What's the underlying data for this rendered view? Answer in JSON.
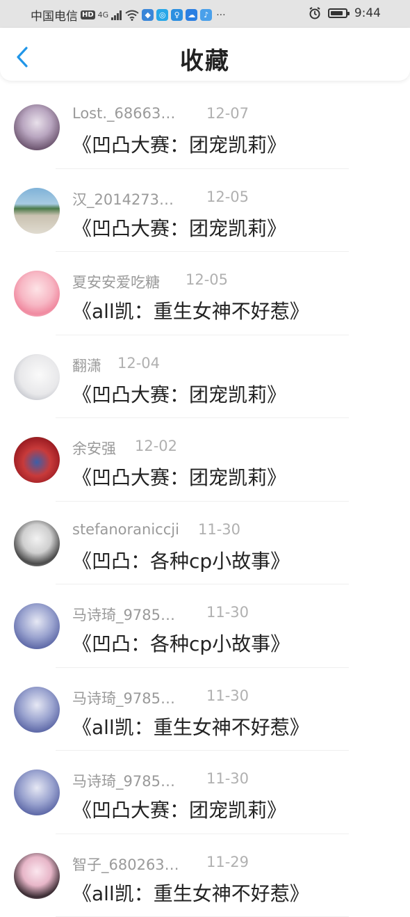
{
  "status_bar": {
    "carrier": "中国电信",
    "hd": "HD",
    "network": "4G",
    "time": "9:44"
  },
  "header": {
    "title": "收藏"
  },
  "items": [
    {
      "name": "Lost._68663…",
      "date": "12-07",
      "book": "《凹凸大赛：团宠凯莉》"
    },
    {
      "name": "汉_2014273…",
      "date": "12-05",
      "book": "《凹凸大赛：团宠凯莉》"
    },
    {
      "name": "夏安安爱吃糖",
      "date": "12-05",
      "book": "《all凯：重生女神不好惹》"
    },
    {
      "name": "翻潇",
      "date": "12-04",
      "book": "《凹凸大赛：团宠凯莉》"
    },
    {
      "name": "余安强",
      "date": "12-02",
      "book": "《凹凸大赛：团宠凯莉》"
    },
    {
      "name": "stefanoraniccji",
      "date": "11-30",
      "book": "《凹凸：各种cp小故事》"
    },
    {
      "name": "马诗琦_9785…",
      "date": "11-30",
      "book": "《凹凸：各种cp小故事》"
    },
    {
      "name": "马诗琦_9785…",
      "date": "11-30",
      "book": "《all凯：重生女神不好惹》"
    },
    {
      "name": "马诗琦_9785…",
      "date": "11-30",
      "book": "《凹凸大赛：团宠凯莉》"
    },
    {
      "name": "智子_680263…",
      "date": "11-29",
      "book": "《all凯：重生女神不好惹》"
    }
  ],
  "colors": {
    "accent": "#2196e8",
    "title": "#222222",
    "name": "#9a9a9a",
    "date": "#b0b0b0"
  }
}
